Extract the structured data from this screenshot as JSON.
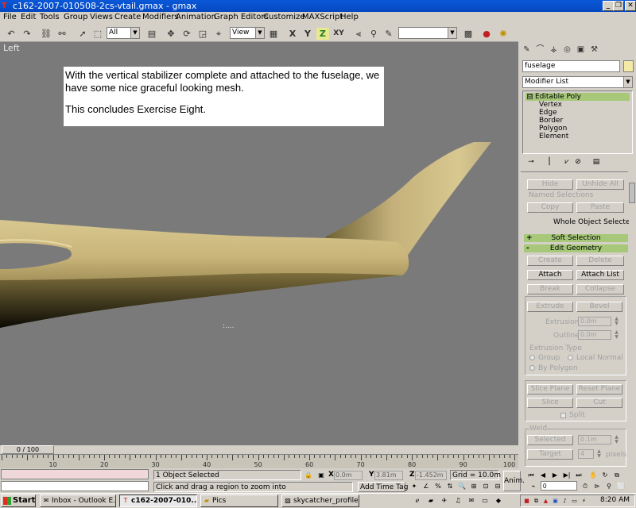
{
  "window": {
    "title": "c162-2007-010508-2cs-vtail.gmax - gmax",
    "minimize": "_",
    "restore": "❐",
    "close": "✕"
  },
  "menu": [
    "File",
    "Edit",
    "Tools",
    "Group",
    "Views",
    "Create",
    "Modifiers",
    "Animation",
    "Graph Editors",
    "Customize",
    "MAXScript",
    "Help"
  ],
  "toolbar": {
    "selection_filter": "All",
    "reference_coord": "View",
    "named_selection": "",
    "axis_x": "X",
    "axis_y": "Y",
    "axis_z": "Z",
    "axis_xy": "XY"
  },
  "viewport": {
    "label": "Left",
    "note_line1": "With the vertical stabilizer complete and attached to the fuselage, we have some nice graceful looking mesh.",
    "note_line2": "This concludes Exercise Eight.",
    "cursor": ":...."
  },
  "command_panel": {
    "object_name": "fuselage",
    "object_color": "#f5e9a8",
    "modifier_list": "Modifier List",
    "stack_root": "Editable Poly",
    "stack_root_toggle": "⊟",
    "sub_objects": [
      "Vertex",
      "Edge",
      "Border",
      "Polygon",
      "Element"
    ],
    "hide_label": "Hide",
    "unhide_all_label": "Unhide All",
    "named_selections_label": "Named Selections",
    "copy_label": "Copy",
    "paste_label": "Paste",
    "whole_object_selected": "Whole Object Selected",
    "soft_selection_label": "Soft Selection",
    "soft_selection_toggle": "+",
    "edit_geometry_label": "Edit Geometry",
    "edit_geometry_toggle": "-",
    "create_label": "Create",
    "delete_label": "Delete",
    "attach_label": "Attach",
    "attach_list_label": "Attach List",
    "break_label": "Break",
    "collapse_label": "Collapse",
    "extrude_label": "Extrude",
    "bevel_label": "Bevel",
    "extrusion_label": "Extrusion",
    "extrusion_value": "0.0m",
    "outline_label": "Outline",
    "outline_value": "0.0m",
    "extrusion_type_label": "Extrusion Type",
    "group_label": "Group",
    "local_normal_label": "Local Normal",
    "by_polygon_label": "By Polygon",
    "slice_plane_label": "Slice Plane",
    "reset_plane_label": "Reset Plane",
    "slice_label": "Slice",
    "cut_label": "Cut",
    "split_label": "Split",
    "weld_label": "Weld",
    "selected_label": "Selected",
    "selected_value": "0.1m",
    "target_label": "Target",
    "target_value": "4",
    "pixels_label": "pixels"
  },
  "timeline": {
    "slider_label": "0 / 100",
    "ticks": [
      "10",
      "20",
      "30",
      "40",
      "50",
      "60",
      "70",
      "80",
      "90",
      "100"
    ]
  },
  "status": {
    "objects_selected": "1 Object Selected",
    "prompt": "Click and drag a region to zoom into",
    "x_label": "X",
    "x_value": "0.0m",
    "y_label": "Y",
    "y_value": "3.81m",
    "z_label": "Z",
    "z_value": "-1.452m",
    "grid": "Grid = 10.0m",
    "add_time_tag": "Add Time Tag",
    "anim_label": "Anim.",
    "frame_value": "0"
  },
  "taskbar": {
    "start_label": "Start",
    "tasks": [
      "Inbox - Outlook E...",
      "c162-2007-010...",
      "Pics",
      "skycatcher_profile..."
    ],
    "clock": "8:20 AM"
  }
}
